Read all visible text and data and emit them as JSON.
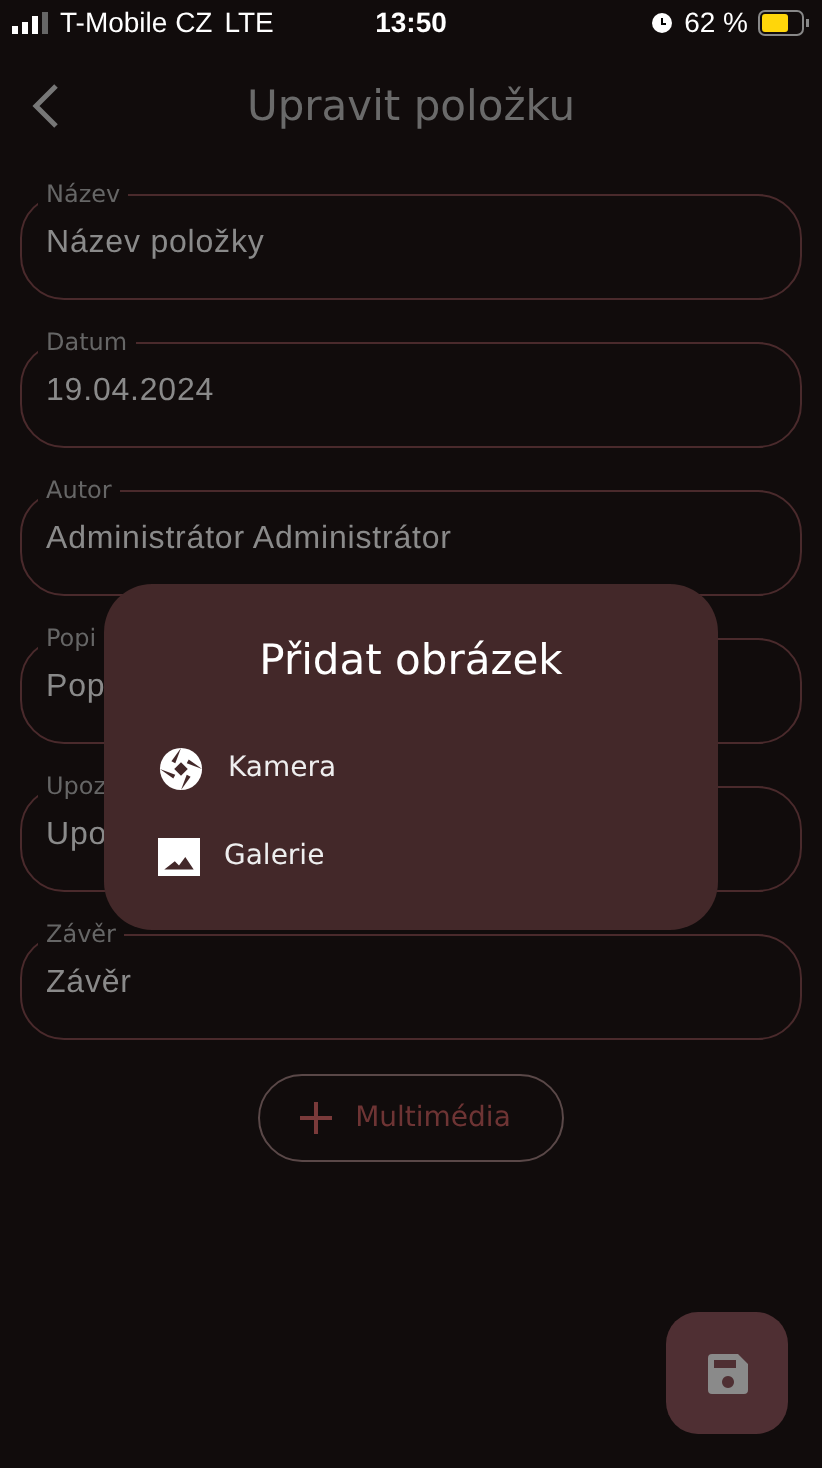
{
  "status_bar": {
    "carrier": "T-Mobile CZ",
    "network": "LTE",
    "time": "13:50",
    "battery": "62 %"
  },
  "header": {
    "title": "Upravit položku"
  },
  "fields": [
    {
      "label": "Název",
      "value": "Název položky"
    },
    {
      "label": "Datum",
      "value": "19.04.2024"
    },
    {
      "label": "Autor",
      "value": "Administrátor Administrátor"
    },
    {
      "label": "Popi",
      "value": "Pop"
    },
    {
      "label": "Upoz",
      "value": "Upo"
    },
    {
      "label": "Závěr",
      "value": "Závěr"
    }
  ],
  "multimedia_button": {
    "label": "Multimédia"
  },
  "dialog": {
    "title": "Přidat obrázek",
    "options": [
      {
        "kind": "camera",
        "label": "Kamera"
      },
      {
        "kind": "gallery",
        "label": "Galerie"
      }
    ]
  }
}
